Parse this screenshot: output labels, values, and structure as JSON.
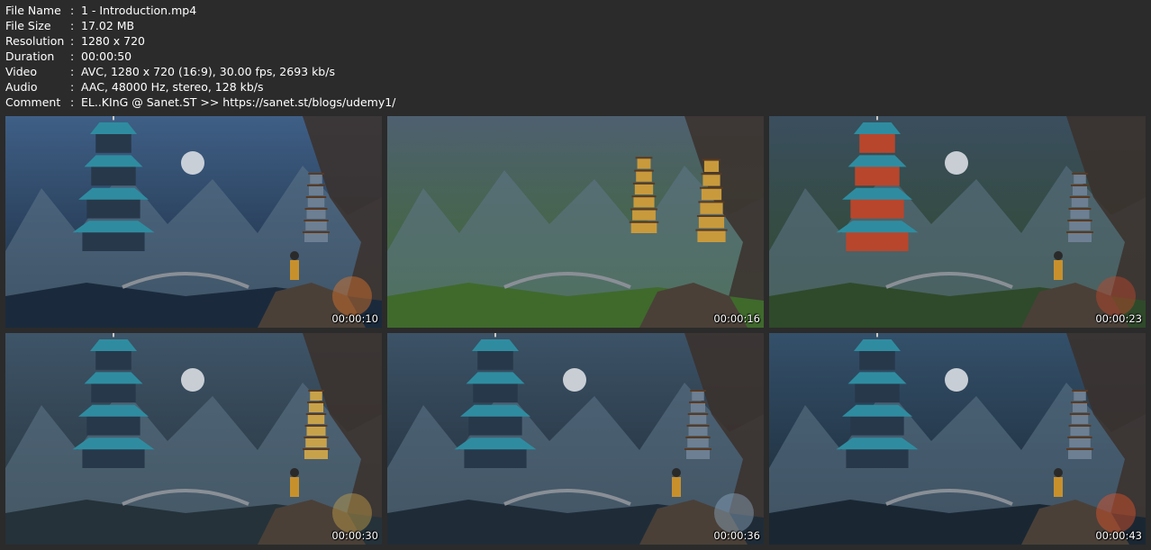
{
  "file_info": [
    {
      "key": "File Name",
      "sep": ":",
      "value": "1 - Introduction.mp4"
    },
    {
      "key": "File Size",
      "sep": ":",
      "value": "17.02 MB"
    },
    {
      "key": "Resolution",
      "sep": ":",
      "value": "1280 x 720"
    },
    {
      "key": "Duration",
      "sep": ":",
      "value": "00:00:50"
    },
    {
      "key": "Video",
      "sep": ":",
      "value": "AVC, 1280 x 720 (16:9), 30.00 fps, 2693 kb/s"
    },
    {
      "key": "Audio",
      "sep": ":",
      "value": "AAC, 48000 Hz, stereo, 128 kb/s"
    },
    {
      "key": "Comment",
      "sep": ":",
      "value": "EL..KInG @ Sanet.ST >> https://sanet.st/blogs/udemy1/"
    }
  ],
  "thumbnails": [
    {
      "time": "00:00:10",
      "scene": "night",
      "sky": "#3f5f86",
      "ground": "#1a2a3c",
      "accent": "#e0762a"
    },
    {
      "time": "00:00:16",
      "scene": "day",
      "sky": "#4e6070",
      "ground": "#3f6a2c",
      "accent": "#c89a3c"
    },
    {
      "time": "00:00:23",
      "scene": "mixed",
      "sky": "#3a4e5e",
      "ground": "#2f4a2a",
      "accent": "#c4462a"
    },
    {
      "time": "00:00:30",
      "scene": "dusk",
      "sky": "#3e5468",
      "ground": "#25323a",
      "accent": "#c8a24a"
    },
    {
      "time": "00:00:36",
      "scene": "blue",
      "sky": "#3c5266",
      "ground": "#1f2c38",
      "accent": "#8fa8c0"
    },
    {
      "time": "00:00:43",
      "scene": "night",
      "sky": "#34506a",
      "ground": "#1a2733",
      "accent": "#e5552a"
    }
  ]
}
